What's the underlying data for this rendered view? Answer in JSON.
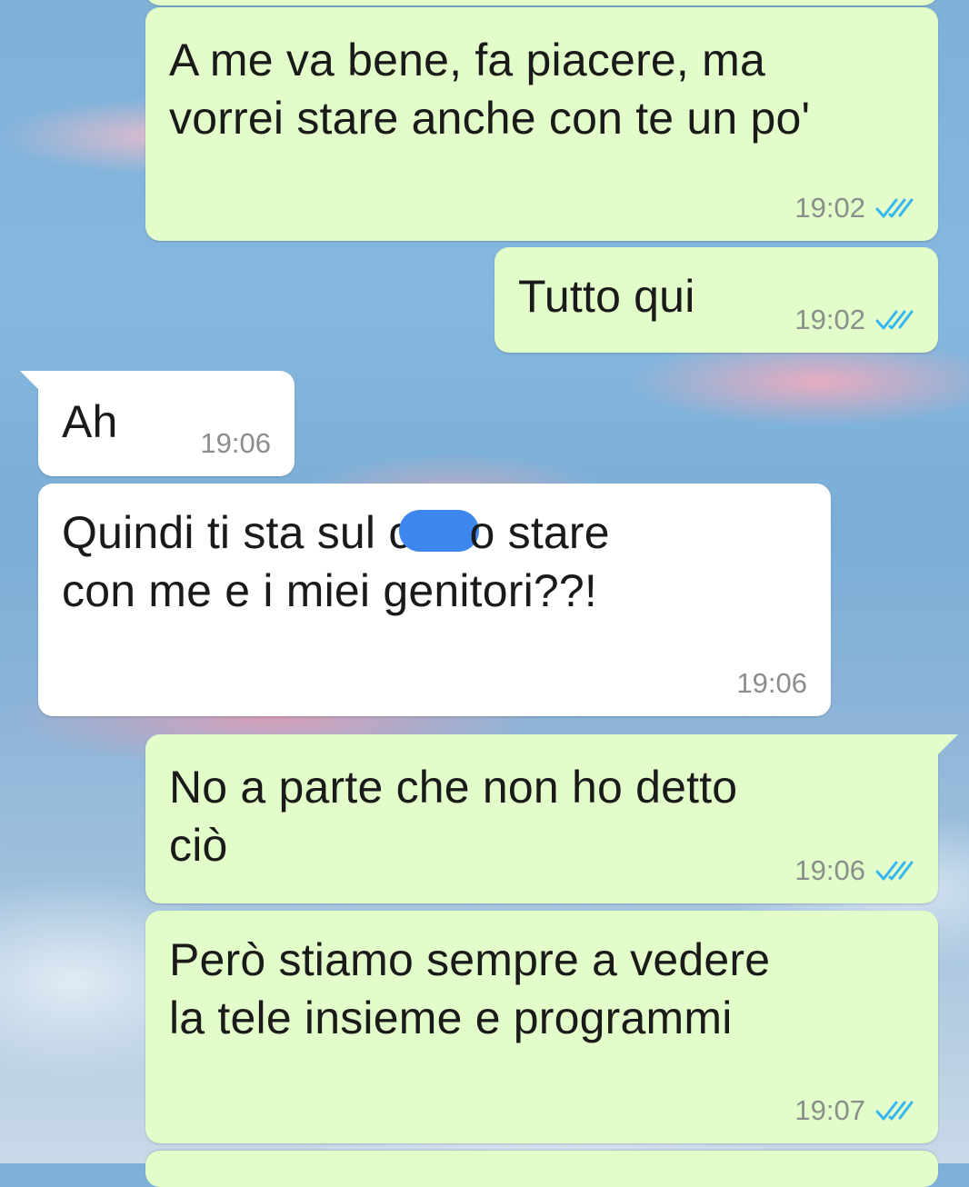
{
  "chat": {
    "messages": [
      {
        "id": "m1",
        "direction": "outgoing",
        "text_lines": [
          "A me va bene, fa piacere, ma",
          "vorrei stare anche con te un po'"
        ],
        "time": "19:02",
        "status": "read",
        "status_icon": "double-check-icon"
      },
      {
        "id": "m2",
        "direction": "outgoing",
        "text_lines": [
          "Tutto qui"
        ],
        "time": "19:02",
        "status": "read",
        "status_icon": "double-check-icon"
      },
      {
        "id": "m3",
        "direction": "incoming",
        "text_lines": [
          "Ah"
        ],
        "time": "19:06"
      },
      {
        "id": "m4",
        "direction": "incoming",
        "text_before_censor": "Quindi ti sta sul c",
        "text_after_censor": "o stare",
        "text_line2": "con me e i miei genitori??!",
        "time": "19:06",
        "censor_color": "#3d86ee"
      },
      {
        "id": "m5",
        "direction": "outgoing",
        "text_lines": [
          "No a parte che non ho detto",
          "ciò"
        ],
        "time": "19:06",
        "status": "read",
        "status_icon": "double-check-icon"
      },
      {
        "id": "m6",
        "direction": "outgoing",
        "text_lines": [
          "Però stiamo sempre a vedere",
          "la tele insieme e programmi"
        ],
        "time": "19:07",
        "status": "read",
        "status_icon": "double-check-icon"
      }
    ]
  },
  "colors": {
    "outgoing_bubble": "#e2fdc9",
    "incoming_bubble": "#ffffff",
    "read_tick": "#34b7f1",
    "timestamp": "#8a8f8c"
  }
}
